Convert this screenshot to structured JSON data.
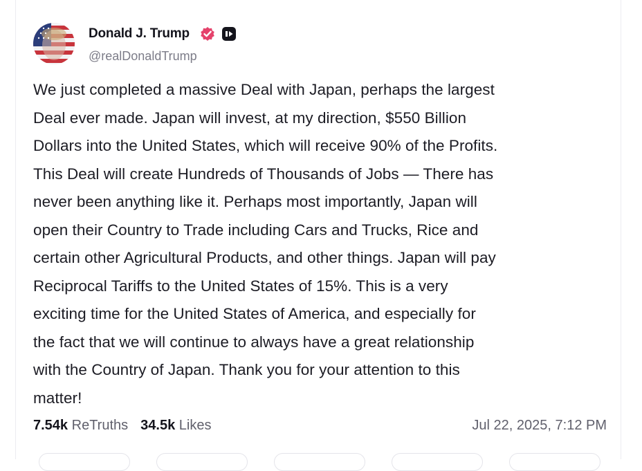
{
  "post": {
    "author_name": "Donald J. Trump",
    "handle": "@realDonaldTrump",
    "text": "We just completed a massive Deal with Japan, perhaps the largest\nDeal ever made. Japan will invest, at my direction, $550 Billion\nDollars into the United States, which will receive 90% of the Profits.\nThis Deal will create Hundreds of Thousands of Jobs — There has\nnever been anything like it. Perhaps most importantly, Japan will\nopen their Country to Trade including Cars and Trucks, Rice and\ncertain other Agricultural Products, and other things. Japan will pay\nReciprocal Tariffs to the United States of 15%. This is a very\nexciting time for the United States of America, and especially for\nthe fact that we will continue to always have a great relationship\nwith the Country of Japan. Thank you for your attention to this\nmatter!",
    "retruths_count": "7.54k",
    "retruths_label": "ReTruths",
    "likes_count": "34.5k",
    "likes_label": "Likes",
    "timestamp": "Jul 22, 2025, 7:12 PM"
  },
  "icons": {
    "verified": "verified-badge-icon",
    "second_badge": "affiliate-badge-icon"
  },
  "colors": {
    "verified": "#e5426b",
    "text": "#1c1c24",
    "muted": "#7c7c88"
  }
}
